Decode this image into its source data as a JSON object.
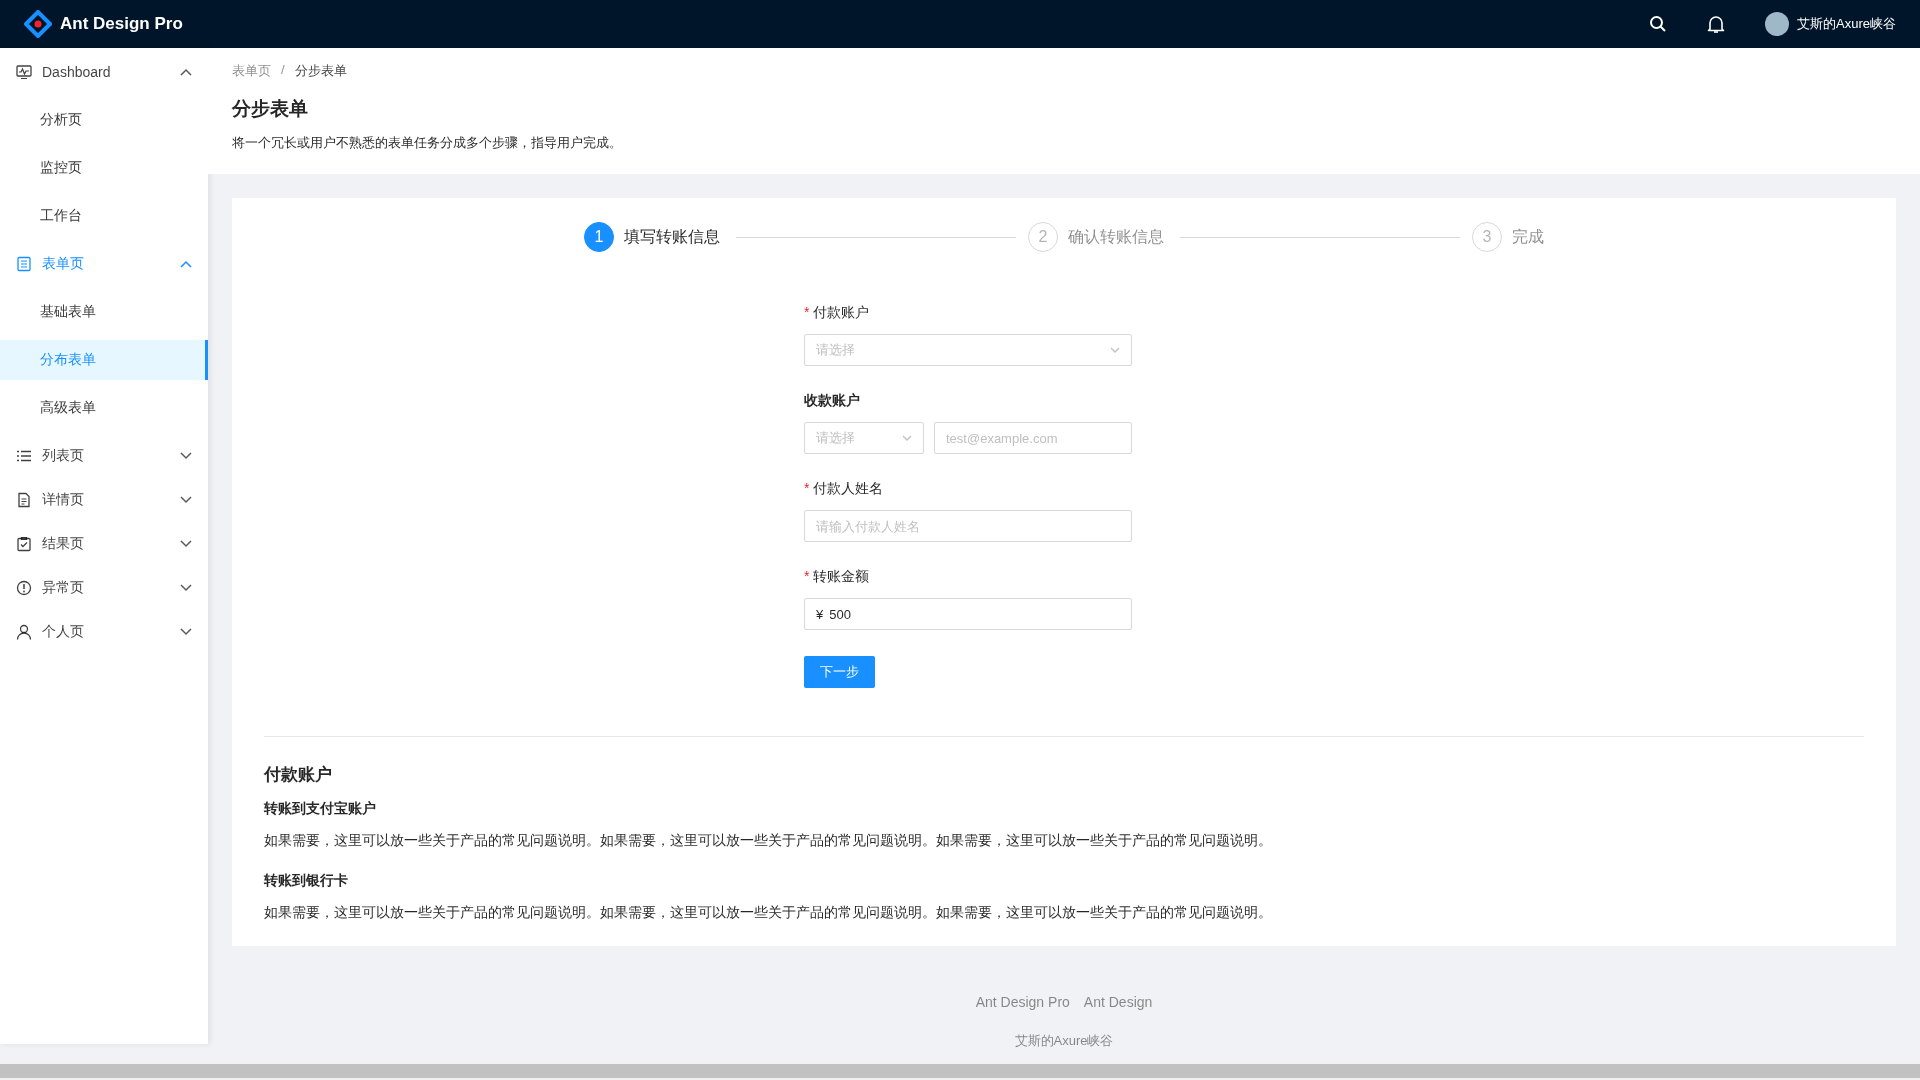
{
  "header": {
    "logo_text": "Ant Design Pro",
    "user_name": "艾斯的Axure峡谷"
  },
  "menu": [
    {
      "label": "Dashboard",
      "expanded": true,
      "children": [
        {
          "label": "分析页",
          "selected": false
        },
        {
          "label": "监控页",
          "selected": false
        },
        {
          "label": "工作台",
          "selected": false
        }
      ]
    },
    {
      "label": "表单页",
      "expanded": true,
      "children": [
        {
          "label": "基础表单",
          "selected": false
        },
        {
          "label": "分布表单",
          "selected": true
        },
        {
          "label": "高级表单",
          "selected": false
        }
      ]
    },
    {
      "label": "列表页",
      "expanded": false
    },
    {
      "label": "详情页",
      "expanded": false
    },
    {
      "label": "结果页",
      "expanded": false
    },
    {
      "label": "异常页",
      "expanded": false
    },
    {
      "label": "个人页",
      "expanded": false
    }
  ],
  "breadcrumb": {
    "items": [
      "表单页",
      "分步表单"
    ],
    "separator": "/"
  },
  "page_title": "分步表单",
  "page_description": "将一个冗长或用户不熟悉的表单任务分成多个步骤，指导用户完成。",
  "steps": [
    {
      "number": "1",
      "title": "填写转账信息",
      "selected": true
    },
    {
      "number": "2",
      "title": "确认转账信息",
      "selected": false
    },
    {
      "number": "3",
      "title": "完成",
      "selected": false
    }
  ],
  "form_fields": [
    {
      "kind": "select",
      "label": "付款账户",
      "required_mark": "*",
      "placeholder": "请选择"
    },
    {
      "kind": "select-input",
      "label": "收款账户",
      "placeholder": "请选择",
      "input_placeholder": "test@example.com"
    },
    {
      "kind": "input",
      "label": "付款人姓名",
      "required_mark": "*",
      "placeholder": "请输入付款人姓名"
    },
    {
      "kind": "amount",
      "label": "转账金额",
      "required_mark": "*",
      "prefix": "¥",
      "value": "500"
    }
  ],
  "submit_button": "下一步",
  "help": {
    "title": "付款账户",
    "sections": [
      {
        "heading": "转账到支付宝账户",
        "text": "如果需要，这里可以放一些关于产品的常见问题说明。如果需要，这里可以放一些关于产品的常见问题说明。如果需要，这里可以放一些关于产品的常见问题说明。"
      },
      {
        "heading": "转账到银行卡",
        "text": "如果需要，这里可以放一些关于产品的常见问题说明。如果需要，这里可以放一些关于产品的常见问题说明。如果需要，这里可以放一些关于产品的常见问题说明。"
      }
    ]
  },
  "footer": {
    "links": [
      "Ant Design Pro",
      "Ant Design"
    ],
    "copyright": "艾斯的Axure峡谷"
  }
}
